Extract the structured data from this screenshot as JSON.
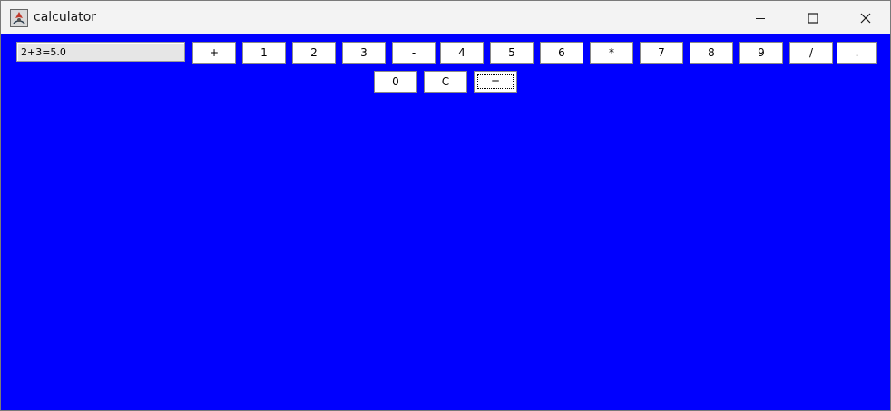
{
  "window": {
    "title": "calculator",
    "app_icon": "java-app-icon",
    "controls": {
      "minimize_icon": "minimize-icon",
      "maximize_icon": "maximize-icon",
      "close_icon": "close-icon"
    }
  },
  "calculator": {
    "display_value": "2+3=5.0",
    "keys_row1": [
      "+",
      "1",
      "2",
      "3",
      "-",
      "4",
      "5",
      "6",
      "*",
      "7",
      "8",
      "9",
      "/",
      "."
    ],
    "keys_row2": [
      "0",
      "C",
      "="
    ],
    "focused_key": "="
  },
  "colors": {
    "background": "#0000ff",
    "button": "#ffffff",
    "display": "#e6e6e6",
    "titlebar": "#f3f3f3"
  }
}
